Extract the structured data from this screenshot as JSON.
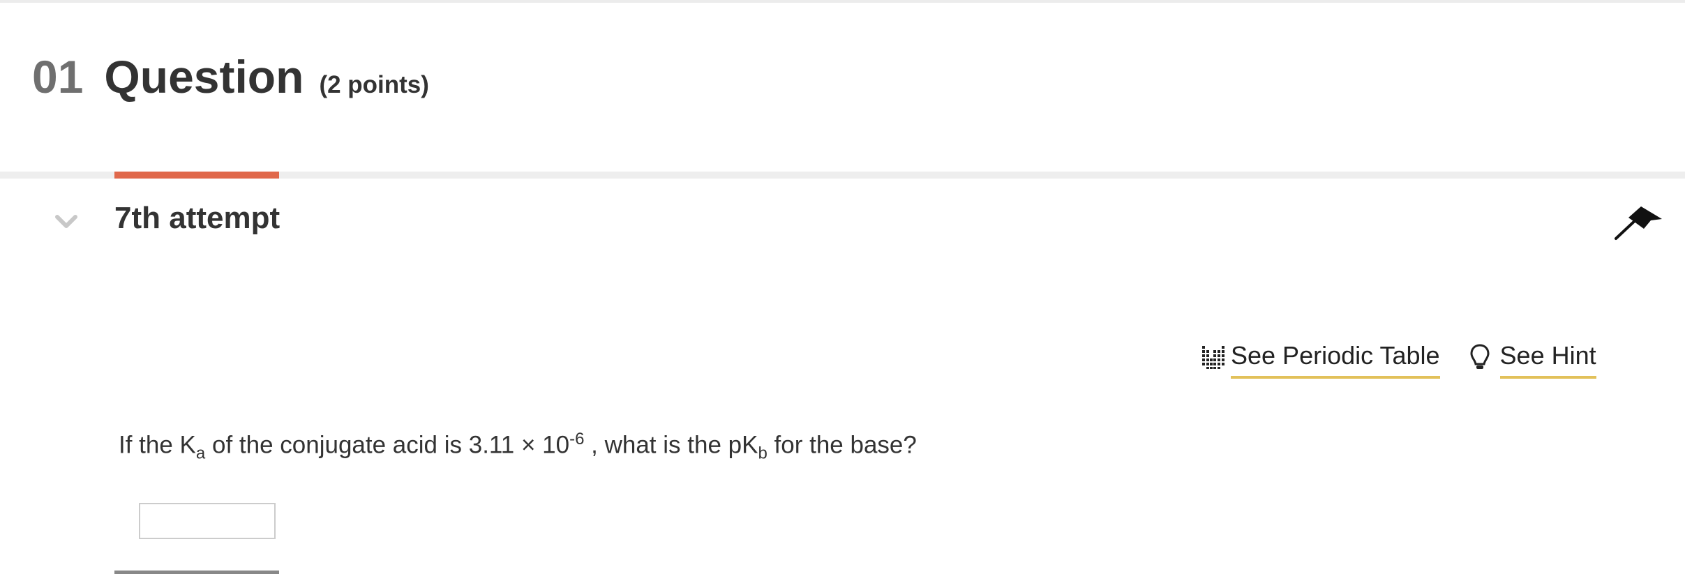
{
  "question": {
    "number": "01",
    "title": "Question",
    "points": "(2 points)"
  },
  "attempt": {
    "label": "7th attempt"
  },
  "tools": {
    "periodic_table": "See Periodic Table",
    "hint": "See Hint"
  },
  "prompt": {
    "part1": "If the K",
    "ka_sub": "a",
    "part2": " of the conjugate acid is 3.11 × 10",
    "exponent": "-6",
    "part3": " , what is the pK",
    "pkb_sub": "b",
    "part4": " for the base?"
  },
  "answer": {
    "value": "",
    "placeholder": ""
  },
  "colors": {
    "accent": "#e0684b",
    "link_underline": "#e2c15a",
    "text": "#333333",
    "muted": "#6f6f6f"
  },
  "icons": [
    "chevron-down-icon",
    "flag-icon",
    "periodic-table-icon",
    "lightbulb-icon"
  ]
}
